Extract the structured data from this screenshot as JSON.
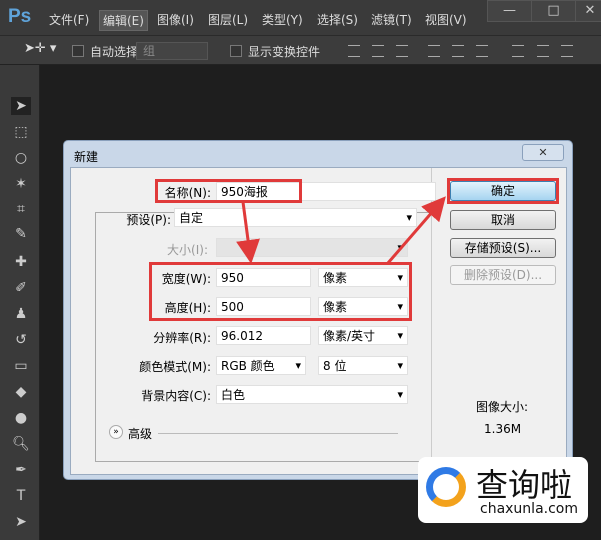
{
  "app": {
    "logo": "Ps"
  },
  "menu": [
    "文件(F)",
    "编辑(E)",
    "图像(I)",
    "图层(L)",
    "类型(Y)",
    "选择(S)",
    "滤镜(T)",
    "视图(V)"
  ],
  "window_buttons": {
    "minimize": "—",
    "maximize": "□",
    "close": "✕"
  },
  "options": {
    "auto_select_label": "自动选择：",
    "auto_select_value": "组",
    "show_transform_label": "显示变换控件"
  },
  "dialog": {
    "title": "新建",
    "close": "✕",
    "name_label": "名称(N):",
    "name_value": "950海报",
    "preset_label": "预设(P):",
    "preset_value": "自定",
    "size_label": "大小(I):",
    "size_value": "",
    "width_label": "宽度(W):",
    "width_value": "950",
    "width_unit": "像素",
    "height_label": "高度(H):",
    "height_value": "500",
    "height_unit": "像素",
    "resolution_label": "分辨率(R):",
    "resolution_value": "96.012",
    "resolution_unit": "像素/英寸",
    "color_mode_label": "颜色模式(M):",
    "color_mode_value": "RGB 颜色",
    "bit_depth": "8 位",
    "background_label": "背景内容(C):",
    "background_value": "白色",
    "advanced_label": "高级",
    "ok": "确定",
    "cancel": "取消",
    "save_preset": "存储预设(S)...",
    "delete_preset": "删除预设(D)...",
    "image_size_label": "图像大小:",
    "image_size_value": "1.36M"
  },
  "watermark": {
    "brand": "查询啦",
    "url": "chaxunla.com"
  },
  "colors": {
    "highlight": "#e03a3a",
    "accent": "#5fa3d9"
  }
}
